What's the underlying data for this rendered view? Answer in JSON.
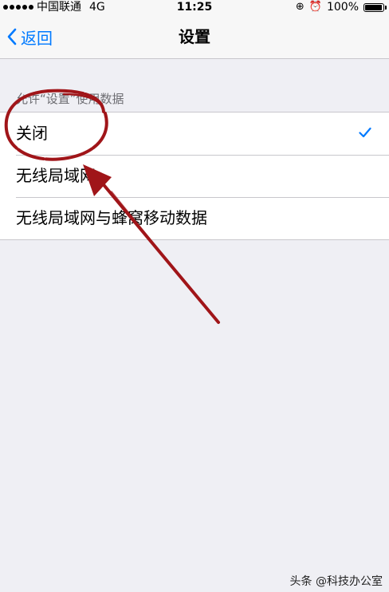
{
  "status_bar": {
    "carrier": "中国联通",
    "network": "4G",
    "time": "11:25",
    "battery": "100%",
    "battery_level": 1.0
  },
  "nav": {
    "back_label": "返回",
    "title": "设置"
  },
  "section": {
    "header": "允许“设置”使用数据"
  },
  "options": [
    {
      "label": "关闭",
      "selected": true
    },
    {
      "label": "无线局域网",
      "selected": false
    },
    {
      "label": "无线局域网与蜂窝移动数据",
      "selected": false
    }
  ],
  "colors": {
    "accent": "#007aff",
    "annotation": "#a01519",
    "background": "#efeff4"
  },
  "watermark": "头条 @科技办公室"
}
